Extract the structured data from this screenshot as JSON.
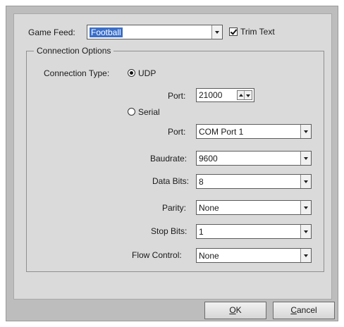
{
  "game_feed": {
    "label": "Game Feed:",
    "value": "Football",
    "trim_text_label": "Trim Text",
    "trim_text_checked": true
  },
  "connection_options": {
    "title": "Connection Options",
    "connection_type_label": "Connection Type:",
    "udp_label": "UDP",
    "udp_selected": true,
    "udp_port_label": "Port:",
    "udp_port_value": "21000",
    "serial_label": "Serial",
    "serial_selected": false,
    "fields": [
      {
        "label": "Port:",
        "value": "COM Port 1"
      },
      {
        "label": "Baudrate:",
        "value": "9600"
      },
      {
        "label": "Data Bits:",
        "value": "8"
      },
      {
        "label": "Parity:",
        "value": "None"
      },
      {
        "label": "Stop Bits:",
        "value": "1"
      },
      {
        "label": "Flow Control:",
        "value": "None"
      }
    ]
  },
  "buttons": {
    "ok_mnemonic": "O",
    "ok_rest": "K",
    "cancel_mnemonic": "C",
    "cancel_rest": "ancel"
  },
  "icons": [
    "dropdown-arrow-icon",
    "checkmark-icon",
    "radio-dot-icon",
    "spin-up-icon",
    "spin-down-icon"
  ]
}
